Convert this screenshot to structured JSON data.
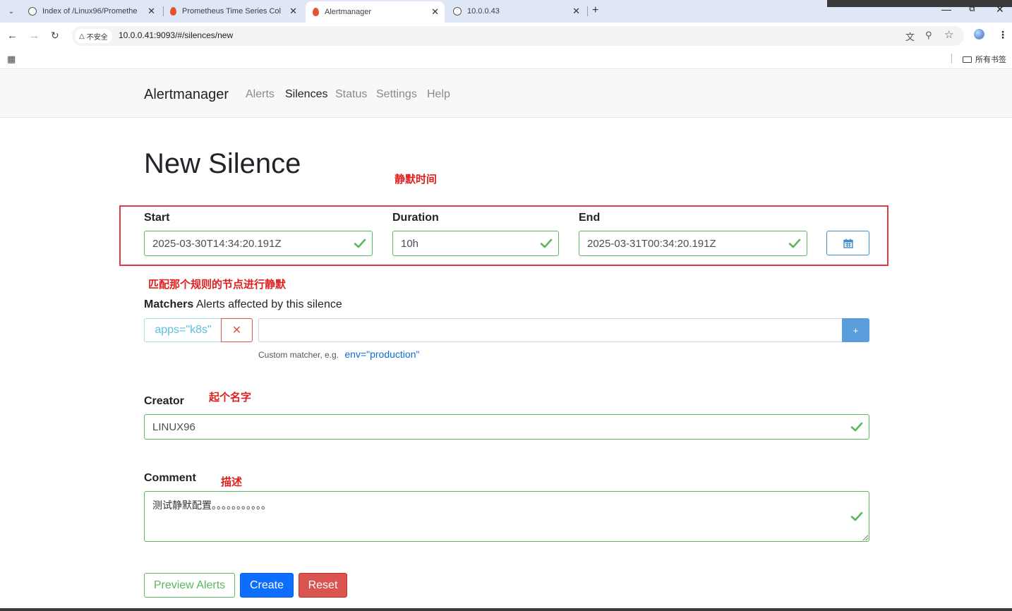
{
  "browser": {
    "tabs": [
      {
        "title": "Index of /Linux96/Promethe",
        "icon": "globe-icon"
      },
      {
        "title": "Prometheus Time Series Coll",
        "icon": "prometheus-flame-icon"
      },
      {
        "title": "Alertmanager",
        "icon": "prometheus-flame-icon",
        "active": true
      },
      {
        "title": "10.0.0.43",
        "icon": "globe-icon"
      }
    ],
    "security_label": "不安全",
    "url": "10.0.0.41:9093/#/silences/new",
    "bookmarks_all": "所有书签"
  },
  "app": {
    "brand": "Alertmanager",
    "nav": [
      "Alerts",
      "Silences",
      "Status",
      "Settings",
      "Help"
    ],
    "active_nav": "Silences"
  },
  "page": {
    "title": "New Silence",
    "annotations": {
      "silence_time": "静默时间",
      "match_rule": "匹配那个规则的节点进行静默",
      "name_it": "起个名字",
      "describe": "描述"
    },
    "start": {
      "label": "Start",
      "value": "2025-03-30T14:34:20.191Z"
    },
    "duration": {
      "label": "Duration",
      "value": "10h"
    },
    "end": {
      "label": "End",
      "value": "2025-03-31T00:34:20.191Z"
    },
    "matchers": {
      "title": "Matchers",
      "subtitle": "Alerts affected by this silence",
      "items": [
        "apps=\"k8s\""
      ],
      "input_value": "",
      "add_label": "+",
      "hint": "Custom matcher, e.g.",
      "hint_example": "env=\"production\""
    },
    "creator": {
      "label": "Creator",
      "value": "LINUX96"
    },
    "comment": {
      "label": "Comment",
      "value": "测试静默配置。。。。。。。。。。。"
    },
    "buttons": {
      "preview": "Preview Alerts",
      "create": "Create",
      "reset": "Reset"
    }
  },
  "colors": {
    "success": "#5cb85c",
    "primary": "#0d6efd",
    "danger": "#d9534f",
    "info": "#5bc0de",
    "annotation": "#e02020"
  }
}
